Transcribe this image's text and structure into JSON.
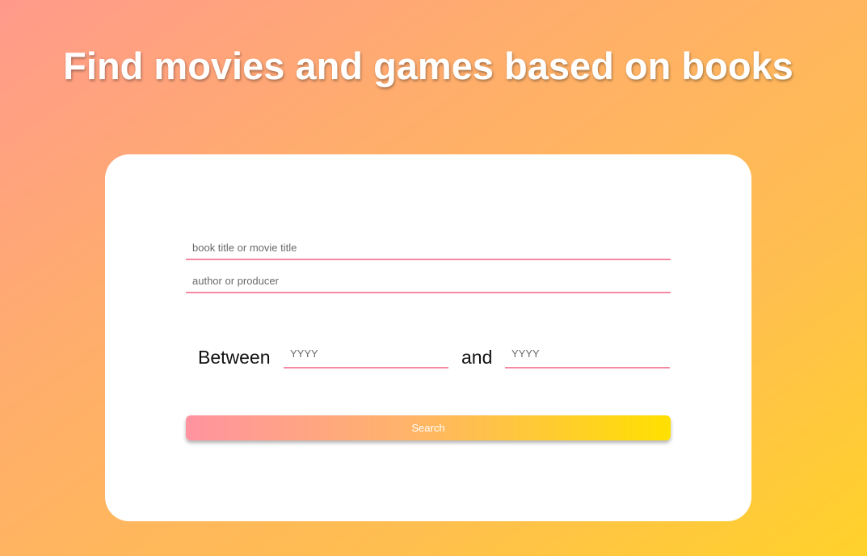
{
  "header": {
    "title": "Find movies and games based on books"
  },
  "form": {
    "title_placeholder": "book title or movie title",
    "author_placeholder": "author or producer",
    "between_label": "Between",
    "and_label": "and",
    "year_from_placeholder": "YYYY",
    "year_to_placeholder": "YYYY",
    "search_label": "Search"
  },
  "colors": {
    "background_gradient": [
      "#ff9a8b",
      "#ffd22a"
    ],
    "field_underline": "#f48aa1",
    "button_gradient": [
      "#ff93a0",
      "#ffe000"
    ]
  }
}
